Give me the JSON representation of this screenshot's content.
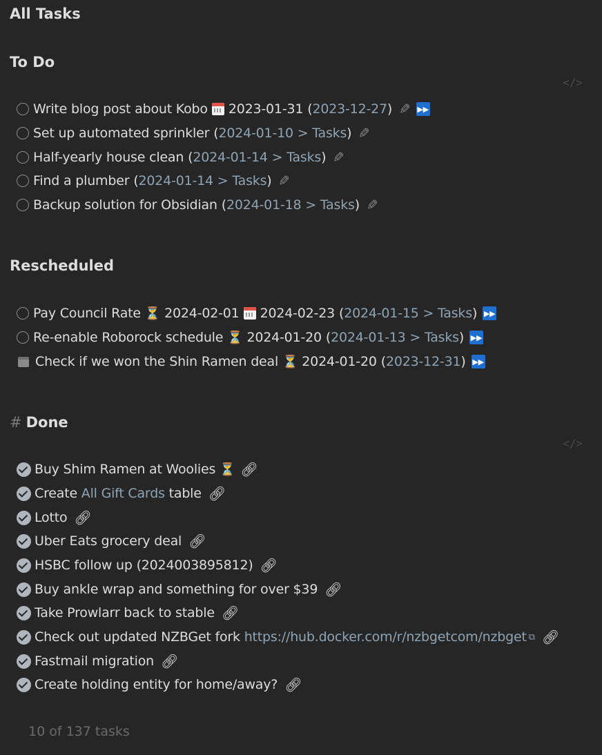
{
  "title": "All Tasks",
  "sections": {
    "todo": {
      "heading": "To Do"
    },
    "rescheduled": {
      "heading": "Rescheduled"
    },
    "done": {
      "hash": "#",
      "heading": "Done"
    }
  },
  "code_icon": "</>",
  "icons": {
    "calendar": "calendar-icon",
    "hourglass": "hourglass-icon",
    "fast_forward": "fast-forward-icon",
    "pencil": "pencil-icon",
    "link": "link-icon",
    "external_link": "external-link-icon",
    "scheduled": "scheduled-calendar-icon"
  },
  "todo_tasks": [
    {
      "text": "Write blog post about Kobo",
      "due": "2023-01-31",
      "open": "(",
      "date_link": "2023-12-27",
      "close": ")"
    },
    {
      "text": "Set up automated sprinkler",
      "open": "(",
      "date_link": "2024-01-10",
      "sep": " > ",
      "note_link": "Tasks",
      "close": ")"
    },
    {
      "text": "Half-yearly house clean",
      "open": "(",
      "date_link": "2024-01-14",
      "sep": " > ",
      "note_link": "Tasks",
      "close": ")"
    },
    {
      "text": "Find a plumber",
      "open": "(",
      "date_link": "2024-01-14",
      "sep": " > ",
      "note_link": "Tasks",
      "close": ")"
    },
    {
      "text": "Backup solution for Obsidian",
      "open": "(",
      "date_link": "2024-01-18",
      "sep": " > ",
      "note_link": "Tasks",
      "close": ")"
    }
  ],
  "rescheduled_tasks": [
    {
      "text": "Pay Council Rate",
      "scheduled": "2024-02-01",
      "due": "2024-02-23",
      "open": "(",
      "date_link": "2024-01-15",
      "sep": " > ",
      "note_link": "Tasks",
      "close": ")"
    },
    {
      "text": "Re-enable Roborock schedule",
      "scheduled": "2024-01-20",
      "open": "(",
      "date_link": "2024-01-13",
      "sep": " > ",
      "note_link": "Tasks",
      "close": ")"
    },
    {
      "text": "Check if we won the Shin Ramen deal",
      "scheduled": "2024-01-20",
      "open": "(",
      "date_link": "2023-12-31",
      "close": ")"
    }
  ],
  "done_tasks": [
    {
      "text": "Buy Shim Ramen at Woolies"
    },
    {
      "pre": "Create ",
      "link": "All Gift Cards",
      "post": " table"
    },
    {
      "text": "Lotto"
    },
    {
      "text": "Uber Eats grocery deal"
    },
    {
      "text": "HSBC follow up (2024003895812)"
    },
    {
      "text": "Buy ankle wrap and something for over $39"
    },
    {
      "text": "Take Prowlarr back to stable"
    },
    {
      "pre": "Check out updated NZBGet fork ",
      "link": "https://hub.docker.com/r/nzbgetcom/nzbget"
    },
    {
      "text": "Fastmail migration"
    },
    {
      "text": "Create holding entity for home/away?"
    }
  ],
  "footer": "10 of 137 tasks"
}
